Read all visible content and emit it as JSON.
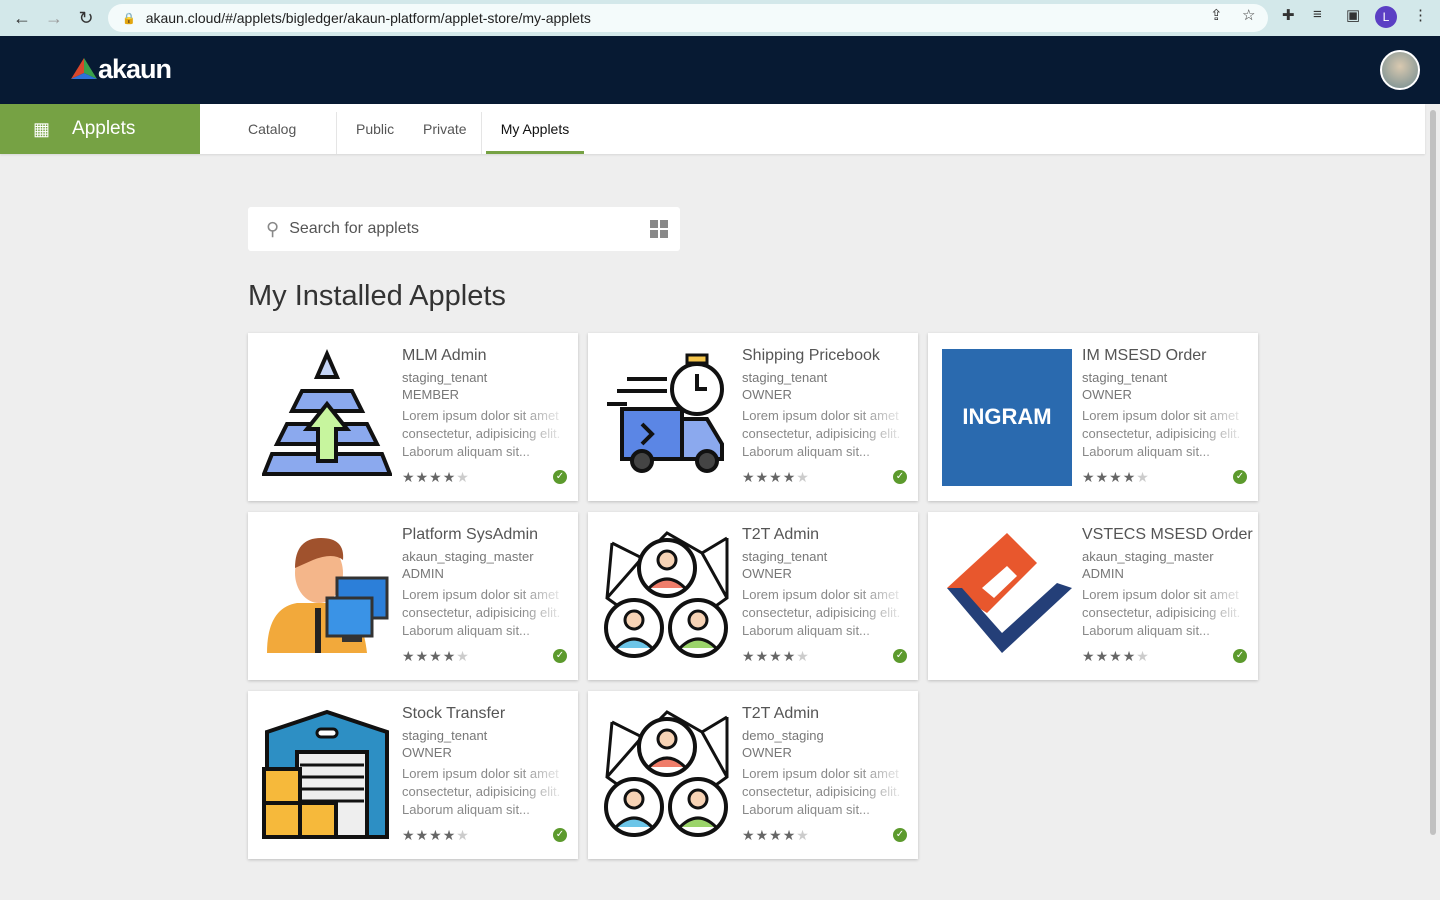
{
  "browser": {
    "url": "akaun.cloud/#/applets/bigledger/akaun-platform/applet-store/my-applets",
    "profile_initial": "L"
  },
  "header": {
    "logo": "akaun"
  },
  "subnav": {
    "section": "Applets",
    "tabs": [
      "Catalog",
      "Public",
      "Private",
      "My Applets"
    ],
    "active": "My Applets"
  },
  "search": {
    "placeholder": "Search for applets"
  },
  "page_title": "My Installed Applets",
  "colors": {
    "accent": "#76a244",
    "topbar": "#071a33",
    "installed": "#5c9a2d"
  },
  "applets": [
    {
      "title": "MLM Admin",
      "tenant": "staging_tenant",
      "role": "MEMBER",
      "description": "Lorem ipsum dolor sit amet consectetur, adipisicing elit. Laborum aliquam sit...",
      "rating": 4,
      "icon": "pyramid-growth-icon"
    },
    {
      "title": "Shipping Pricebook",
      "tenant": "staging_tenant",
      "role": "OWNER",
      "description": "Lorem ipsum dolor sit amet consectetur, adipisicing elit. Laborum aliquam sit...",
      "rating": 4,
      "icon": "delivery-truck-icon"
    },
    {
      "title": "IM MSESD Order",
      "tenant": "staging_tenant",
      "role": "OWNER",
      "description": "Lorem ipsum dolor sit amet consectetur, adipisicing elit. Laborum aliquam sit...",
      "rating": 4,
      "icon": "ingram-logo",
      "logo_text": "INGRAM"
    },
    {
      "title": "Platform SysAdmin",
      "tenant": "akaun_staging_master",
      "role": "ADMIN",
      "description": "Lorem ipsum dolor sit amet consectetur, adipisicing elit. Laborum aliquam sit...",
      "rating": 4,
      "icon": "sysadmin-icon"
    },
    {
      "title": "T2T Admin",
      "tenant": "staging_tenant",
      "role": "OWNER",
      "description": "Lorem ipsum dolor sit amet consectetur, adipisicing elit. Laborum aliquam sit...",
      "rating": 4,
      "icon": "network-people-icon"
    },
    {
      "title": "VSTECS MSESD Order",
      "tenant": "akaun_staging_master",
      "role": "ADMIN",
      "description": "Lorem ipsum dolor sit amet consectetur, adipisicing elit. Laborum aliquam sit...",
      "rating": 4,
      "icon": "vstecs-logo"
    },
    {
      "title": "Stock Transfer",
      "tenant": "staging_tenant",
      "role": "OWNER",
      "description": "Lorem ipsum dolor sit amet consectetur, adipisicing elit. Laborum aliquam sit...",
      "rating": 4,
      "icon": "warehouse-icon"
    },
    {
      "title": "T2T Admin",
      "tenant": "demo_staging",
      "role": "OWNER",
      "description": "Lorem ipsum dolor sit amet consectetur, adipisicing elit. Laborum aliquam sit...",
      "rating": 4,
      "icon": "network-people-icon"
    }
  ]
}
